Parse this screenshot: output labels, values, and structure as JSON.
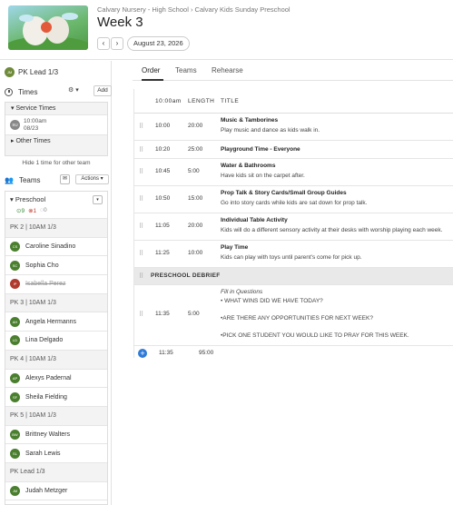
{
  "header": {
    "breadcrumb": "Calvary Nursery - High School › Calvary Kids Sunday Preschool",
    "title": "Week 3",
    "prev_label": "‹",
    "next_label": "›",
    "date": "August 23, 2026"
  },
  "sidebar": {
    "current_position": "PK Lead 1/3",
    "current_avatar": "JM",
    "times_label": "Times",
    "add_label": "Add",
    "service_times_label": "Service Times",
    "service": {
      "badge": "SU",
      "time": "10:00am",
      "date": "08/23"
    },
    "other_times_label": "Other Times",
    "hide_note": "Hide 1 time for other team",
    "teams_label": "Teams",
    "actions_label": "Actions",
    "team": {
      "name": "Preschool",
      "confirmed": "9",
      "declined": "1",
      "unconfirmed": "0"
    },
    "roster": [
      {
        "type": "position",
        "label": "PK 2 | 10AM 1/3"
      },
      {
        "type": "member",
        "name": "Caroline Sinadino",
        "avatar": "CS",
        "status": "confirmed"
      },
      {
        "type": "member",
        "name": "Sophia Cho",
        "avatar": "SC",
        "status": "confirmed"
      },
      {
        "type": "member",
        "name": "Isabella Perez",
        "avatar": "IP",
        "status": "declined"
      },
      {
        "type": "position",
        "label": "PK 3 | 10AM 1/3"
      },
      {
        "type": "member",
        "name": "Angela Hermanns",
        "avatar": "AH",
        "status": "confirmed"
      },
      {
        "type": "member",
        "name": "Lina Delgado",
        "avatar": "LD",
        "status": "confirmed"
      },
      {
        "type": "position",
        "label": "PK 4 | 10AM 1/3"
      },
      {
        "type": "member",
        "name": "Alexys Padernal",
        "avatar": "AP",
        "status": "confirmed"
      },
      {
        "type": "member",
        "name": "Sheila Fielding",
        "avatar": "SF",
        "status": "confirmed"
      },
      {
        "type": "position",
        "label": "PK 5 | 10AM 1/3"
      },
      {
        "type": "member",
        "name": "Brittney Walters",
        "avatar": "BW",
        "status": "confirmed"
      },
      {
        "type": "member",
        "name": "Sarah Lewis",
        "avatar": "SL",
        "status": "confirmed"
      },
      {
        "type": "position",
        "label": "PK Lead 1/3"
      },
      {
        "type": "member",
        "name": "Judah Metzger",
        "avatar": "JM",
        "status": "confirmed"
      }
    ]
  },
  "tabs": [
    "Order",
    "Teams",
    "Rehearse"
  ],
  "order": {
    "columns": {
      "time": "10:00am",
      "length": "LENGTH",
      "title": "TITLE"
    },
    "items": [
      {
        "start": "10:00",
        "length": "20:00",
        "title": "Music & Tamborines",
        "desc": "Play music and dance as kids walk in."
      },
      {
        "start": "10:20",
        "length": "25:00",
        "title": "Playground Time - Everyone",
        "desc": ""
      },
      {
        "start": "10:45",
        "length": "5:00",
        "title": "Water & Bathrooms",
        "desc": "Have kids sit on the carpet after."
      },
      {
        "start": "10:50",
        "length": "15:00",
        "title": "Prop Talk & Story Cards/Small Group Guides",
        "desc": "Go into story cards while kids are sat down for prop talk."
      },
      {
        "start": "11:05",
        "length": "20:00",
        "title": "Individual Table Activity",
        "desc": "Kids will do a different sensory activity at their desks with worship playing each week."
      },
      {
        "start": "11:25",
        "length": "10:00",
        "title": "Play Time",
        "desc": "Kids can play with toys until parent's come for pick up."
      }
    ],
    "section_header": "PRESCHOOL DEBRIEF",
    "debrief": {
      "start": "11:35",
      "length": "5:00",
      "lead": "Fill in Questions",
      "lines": [
        "• WHAT WINS DID WE HAVE TODAY?",
        "•ARE THERE ANY OPPORTUNITIES FOR NEXT WEEK?",
        "•PICK ONE STUDENT YOU WOULD LIKE TO PRAY FOR THIS WEEK."
      ]
    },
    "footer": {
      "end_time": "11:35",
      "total": "95:00"
    }
  }
}
